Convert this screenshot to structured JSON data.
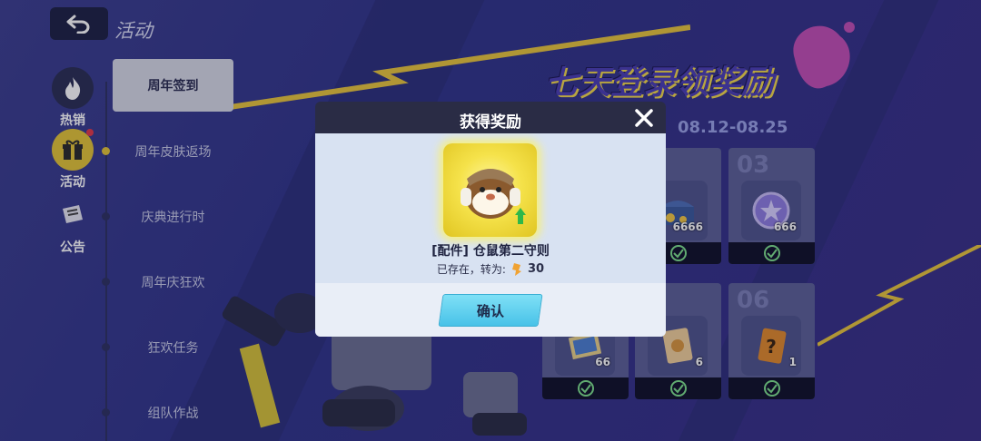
{
  "header": {
    "title": "活动"
  },
  "sidebar": {
    "items": [
      {
        "label": "热销",
        "icon": "flame-icon"
      },
      {
        "label": "活动",
        "icon": "gift-icon",
        "active": true
      },
      {
        "label": "公告",
        "icon": "notice-icon"
      }
    ]
  },
  "activities": [
    {
      "label": "周年签到",
      "active": true
    },
    {
      "label": "周年皮肤返场"
    },
    {
      "label": "庆典进行时"
    },
    {
      "label": "周年庆狂欢"
    },
    {
      "label": "狂欢任务"
    },
    {
      "label": "组队作战"
    }
  ],
  "event": {
    "title": "七天登录领奖励",
    "date": "08.12-08.25",
    "cards": [
      {
        "num": "",
        "qty": "6666",
        "icon": "treasure-chest-icon"
      },
      {
        "num": "03",
        "qty": "666",
        "icon": "star-coin-icon"
      },
      {
        "num": "",
        "qty": "66",
        "icon": "scroll-icon"
      },
      {
        "num": "",
        "qty": "6",
        "icon": "ticket-icon"
      },
      {
        "num": "06",
        "qty": "1",
        "icon": "mystery-card-icon"
      }
    ]
  },
  "dialog": {
    "title": "获得奖励",
    "reward_name": "[配件] 仓鼠第二守则",
    "converted_text": "已存在，转为:",
    "converted_amount": "30",
    "confirm_label": "确认"
  },
  "colors": {
    "accent_yellow": "#e3c437",
    "confirm_blue": "#48c2e8",
    "background": "#33378a"
  }
}
